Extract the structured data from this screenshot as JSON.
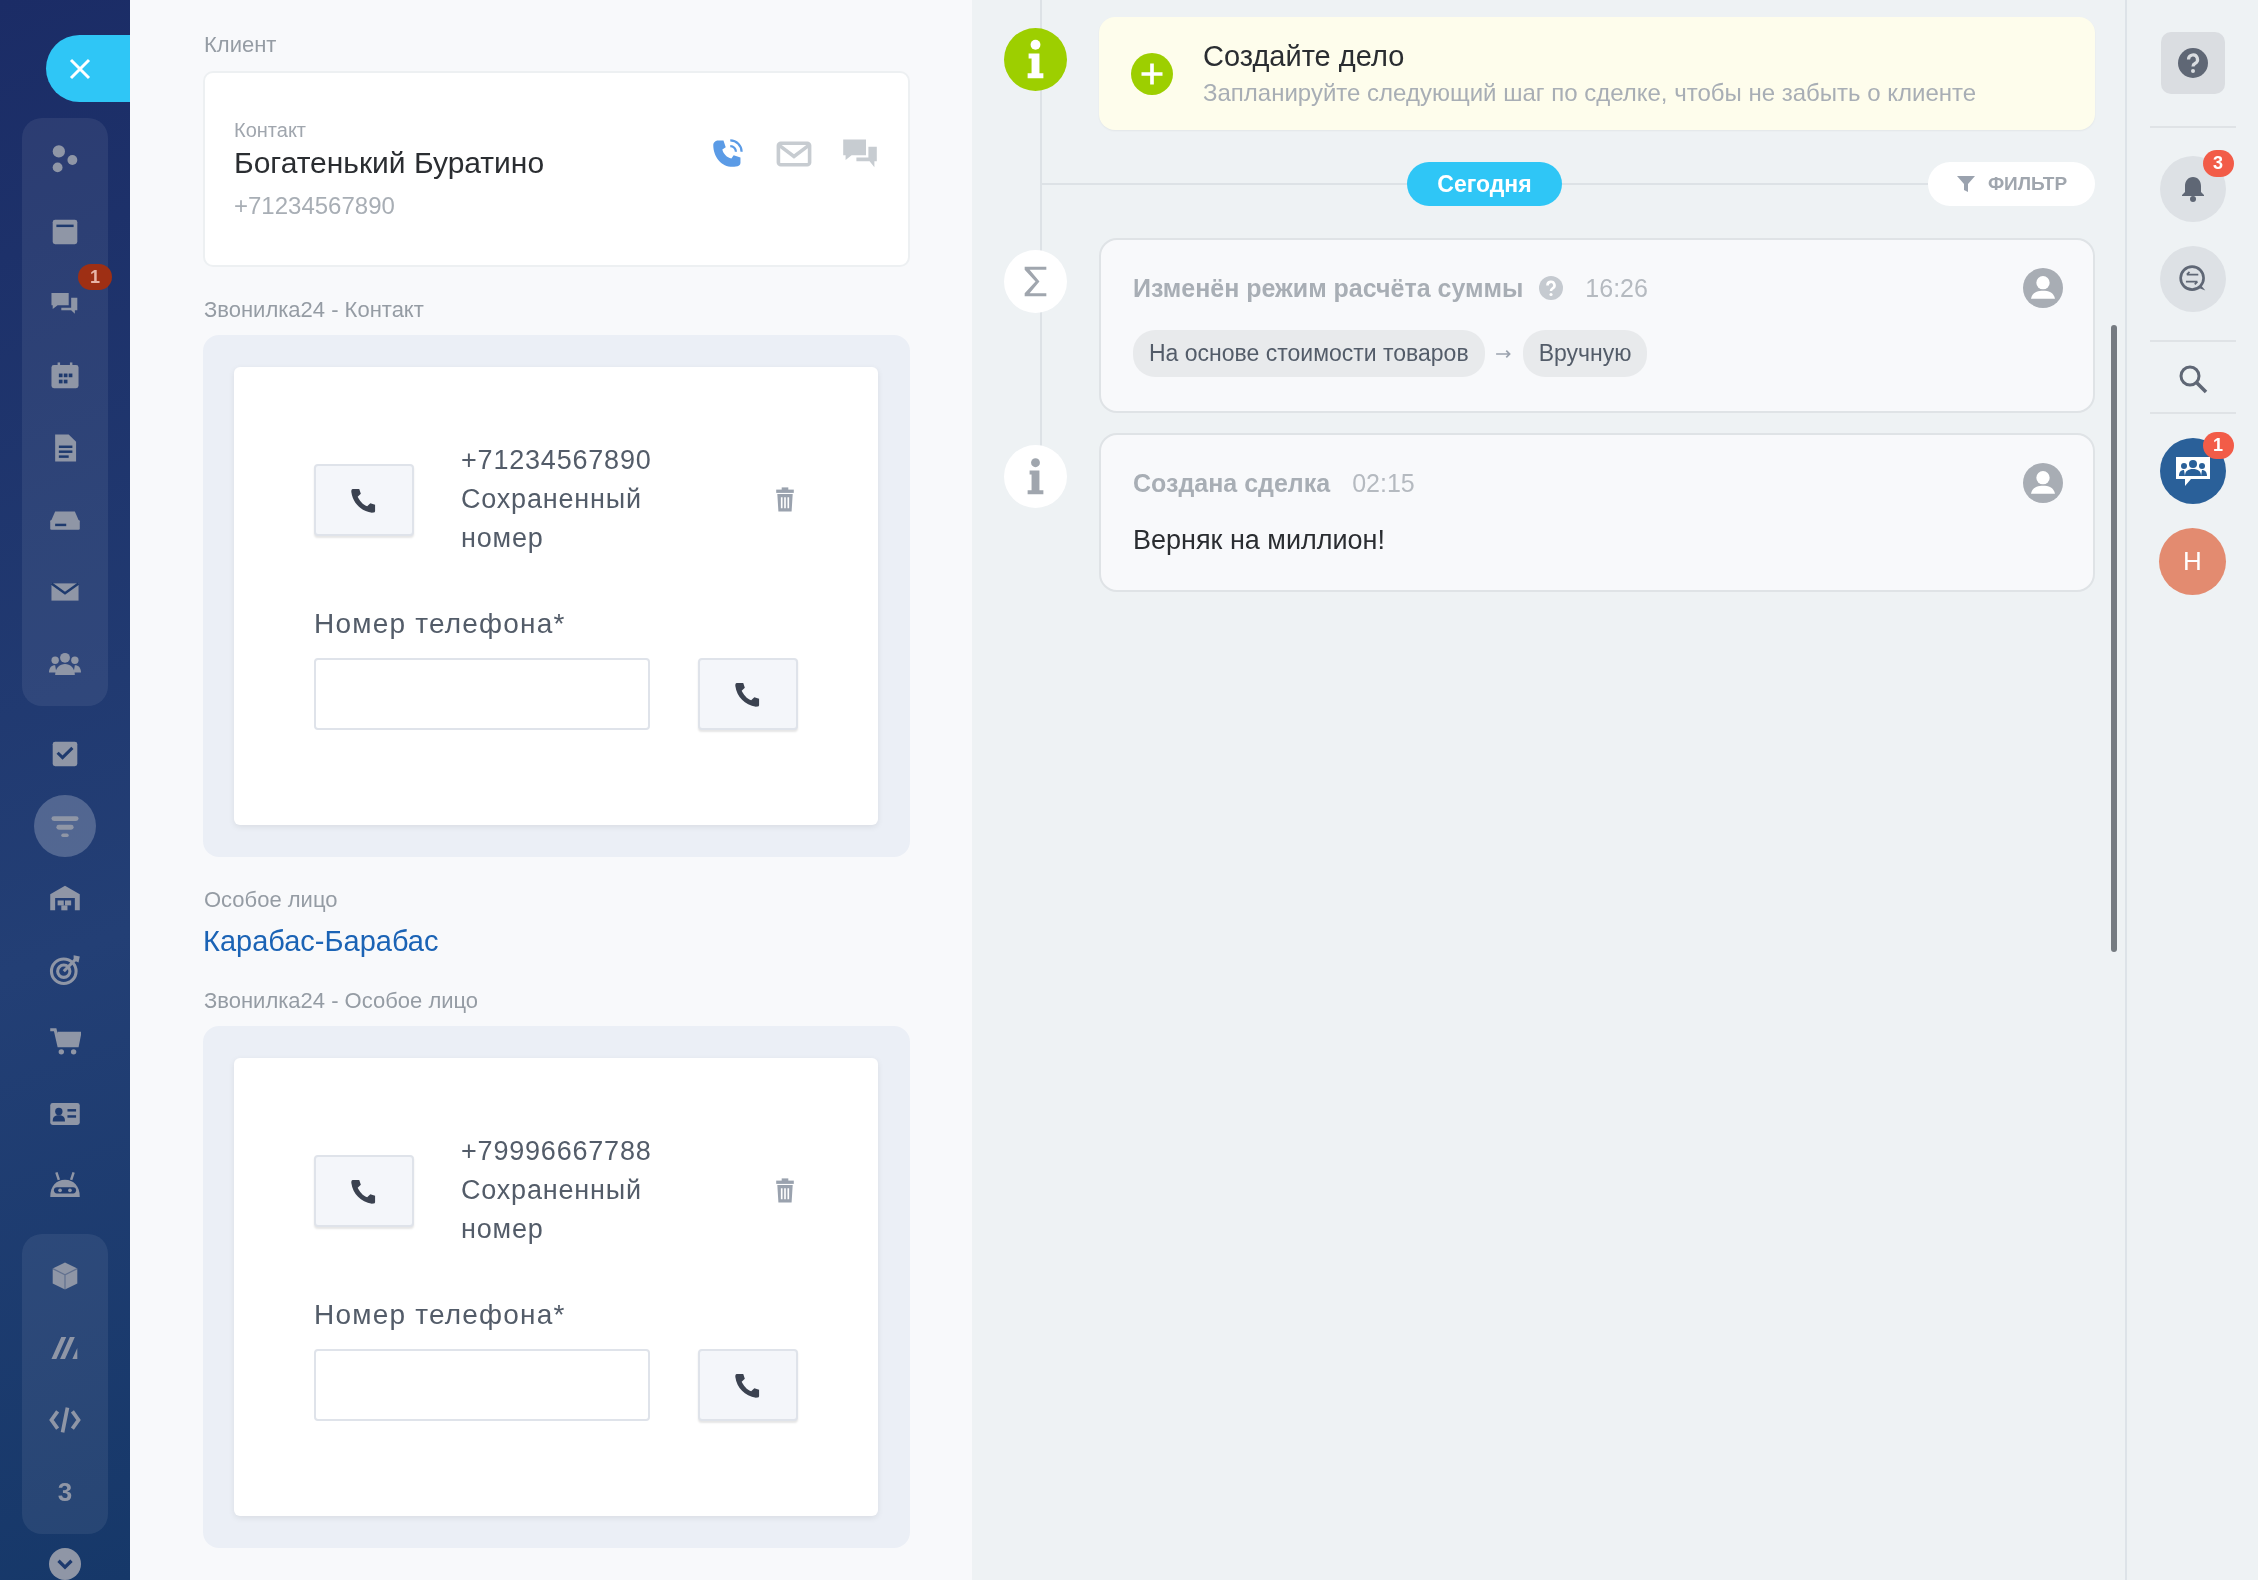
{
  "nav": {
    "sections": [
      {
        "framed": true,
        "items": [
          {
            "selected": false
          },
          {
            "selected": false
          },
          {
            "selected": false,
            "badge": "1"
          },
          {
            "selected": false
          },
          {
            "selected": false
          },
          {
            "selected": false
          },
          {
            "selected": false
          },
          {
            "selected": false
          }
        ]
      },
      {
        "framed": false,
        "items": [
          {
            "selected": false
          },
          {
            "selected": true
          },
          {
            "selected": false
          },
          {
            "selected": false
          },
          {
            "selected": false
          },
          {
            "selected": false
          },
          {
            "selected": false
          }
        ]
      },
      {
        "framed": true,
        "items": [
          {
            "selected": false
          },
          {
            "selected": false
          },
          {
            "selected": false
          },
          {
            "selected": false,
            "label": "3"
          }
        ]
      }
    ]
  },
  "client": {
    "label": "Клиент",
    "card": {
      "caption": "Контакт",
      "name": "Богатенький Буратино",
      "phone": "+71234567890"
    }
  },
  "contact_dialer": {
    "label": "Звонилка24 - Контакт",
    "saved_number": "+71234567890",
    "saved_caption": "Сохраненный номер",
    "field_label": "Номер телефона*"
  },
  "special_person": {
    "label": "Особое лицо",
    "link": "Карабас-Барабас"
  },
  "person_dialer": {
    "label": "Звонилка24 - Особое лицо",
    "saved_number": "+79996667788",
    "saved_caption": "Сохраненный номер",
    "field_label": "Номер телефона*"
  },
  "timeline": {
    "todo": {
      "title": "Создайте дело",
      "subtitle": "Запланируйте следующий шаг по сделке, чтобы не забыть о клиенте"
    },
    "today": "Сегодня",
    "filter": "ФИЛЬТР",
    "events": [
      {
        "kind": "sum",
        "title": "Изменён режим расчёта суммы",
        "help": true,
        "time": "16:26",
        "from": "На основе стоимости товаров",
        "to": "Вручную"
      },
      {
        "kind": "info",
        "title": "Создана сделка",
        "help": false,
        "time": "02:15",
        "text": "Верняк на миллион!"
      }
    ]
  },
  "rail": {
    "notifications_badge": "3",
    "open_lines_badge": "1",
    "avatar": "Н"
  }
}
